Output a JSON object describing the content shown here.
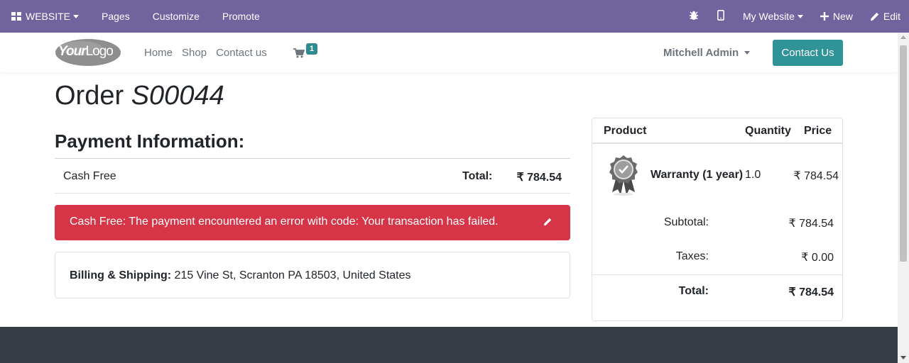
{
  "admin_bar": {
    "website_menu": "WEBSITE",
    "pages": "Pages",
    "customize": "Customize",
    "promote": "Promote",
    "my_website": "My Website",
    "new": "New",
    "edit": "Edit",
    "bg_color": "#71639e"
  },
  "header": {
    "logo_text_your": "Your",
    "logo_text_logo": "Logo",
    "nav": [
      "Home",
      "Shop",
      "Contact us"
    ],
    "cart_count": "1",
    "user_name": "Mitchell Admin",
    "contact_button": "Contact Us",
    "accent_color": "#2f9397"
  },
  "order": {
    "title_prefix": "Order",
    "number": "S00044"
  },
  "payment": {
    "heading": "Payment Information:",
    "provider": "Cash Free",
    "total_label": "Total:",
    "total_value": "₹ 784.54",
    "error_message": "Cash Free: The payment encountered an error with code: Your transaction has failed.",
    "error_color": "#d63447"
  },
  "billing": {
    "label": "Billing & Shipping:",
    "address": " 215 Vine St, Scranton PA 18503, United States"
  },
  "summary": {
    "columns": [
      "Product",
      "Quantity",
      "Price"
    ],
    "product_name": "Warranty (1 year)",
    "product_qty": "1.0",
    "product_price": "₹ 784.54",
    "subtotal_label": "Subtotal:",
    "subtotal_value": "₹ 784.54",
    "taxes_label": "Taxes:",
    "taxes_value": "₹ 0.00",
    "total_label": "Total:",
    "total_value": "₹ 784.54"
  }
}
